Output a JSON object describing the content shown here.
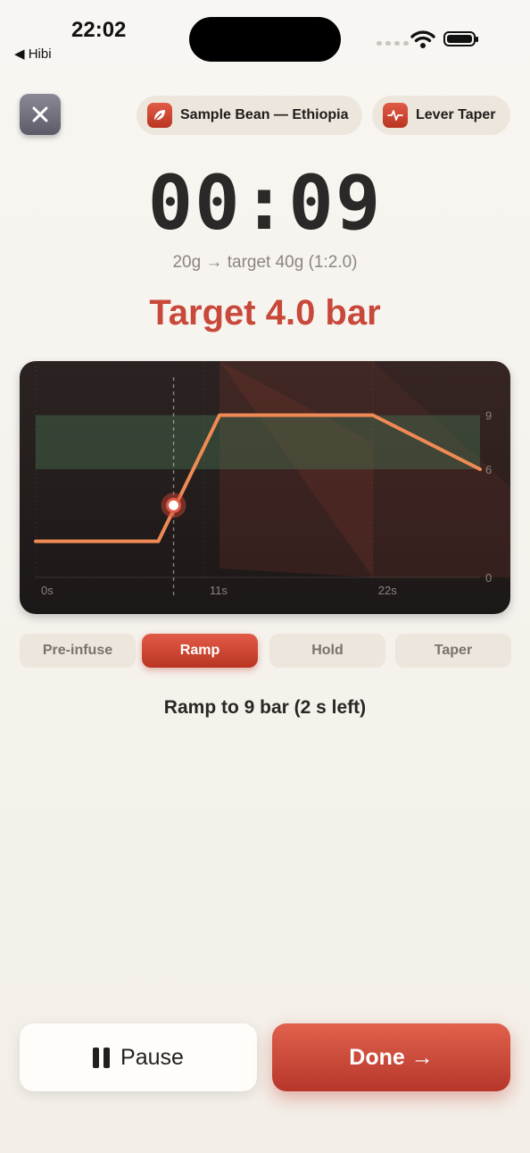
{
  "status_bar": {
    "time": "22:02",
    "back_app": "◀ Hibi"
  },
  "header": {
    "close_label": "✕",
    "bean_chip": {
      "label": "Sample Bean — Ethiopia",
      "icon": "leaf-icon"
    },
    "profile_chip": {
      "label": "Lever Taper",
      "icon": "pulse-icon"
    }
  },
  "timer": {
    "display": "00:09"
  },
  "dose": {
    "text": "20g → target 40g (1:2.0)"
  },
  "target": {
    "text": "Target 4.0 bar"
  },
  "chart_data": {
    "type": "line",
    "x_unit": "s",
    "y_unit": "bar",
    "xlim": [
      0,
      29
    ],
    "ylim": [
      0,
      12
    ],
    "x_ticks": [
      "0s",
      "11s",
      "22s"
    ],
    "x_tick_values": [
      0,
      11,
      22
    ],
    "y_ticks": [
      "9",
      "6",
      "0"
    ],
    "y_tick_values": [
      9,
      6,
      0
    ],
    "target_band": [
      6,
      9
    ],
    "cursor_x": 9,
    "series": [
      {
        "color": "#f08a55",
        "points": [
          [
            0,
            2
          ],
          [
            8,
            2
          ],
          [
            12,
            9
          ],
          [
            22,
            9
          ],
          [
            29,
            6
          ]
        ]
      }
    ],
    "current_point": [
      9,
      4.0
    ]
  },
  "phases": {
    "items": [
      {
        "label": "Pre-infuse",
        "active": false
      },
      {
        "label": "Ramp",
        "active": true
      },
      {
        "label": "Hold",
        "active": false
      },
      {
        "label": "Taper",
        "active": false
      }
    ]
  },
  "stage_hint": {
    "text": "Ramp to 9 bar (2 s left)"
  },
  "actions": {
    "pause_label": "Pause",
    "done_label": "Done →"
  },
  "colors": {
    "accent": "#c8483a",
    "chart_line": "#f08a55",
    "band": "#3d5f45"
  }
}
